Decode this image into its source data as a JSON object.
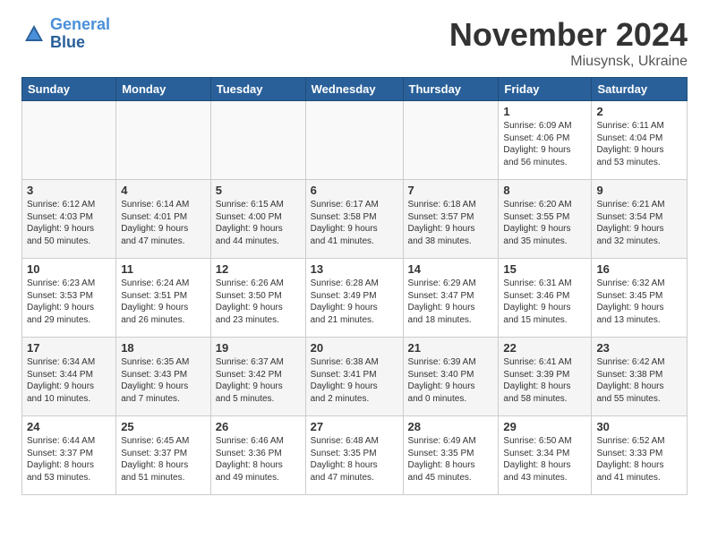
{
  "header": {
    "logo_line1": "General",
    "logo_line2": "Blue",
    "month": "November 2024",
    "location": "Miusynsk, Ukraine"
  },
  "days_of_week": [
    "Sunday",
    "Monday",
    "Tuesday",
    "Wednesday",
    "Thursday",
    "Friday",
    "Saturday"
  ],
  "weeks": [
    [
      {
        "num": "",
        "info": ""
      },
      {
        "num": "",
        "info": ""
      },
      {
        "num": "",
        "info": ""
      },
      {
        "num": "",
        "info": ""
      },
      {
        "num": "",
        "info": ""
      },
      {
        "num": "1",
        "info": "Sunrise: 6:09 AM\nSunset: 4:06 PM\nDaylight: 9 hours\nand 56 minutes."
      },
      {
        "num": "2",
        "info": "Sunrise: 6:11 AM\nSunset: 4:04 PM\nDaylight: 9 hours\nand 53 minutes."
      }
    ],
    [
      {
        "num": "3",
        "info": "Sunrise: 6:12 AM\nSunset: 4:03 PM\nDaylight: 9 hours\nand 50 minutes."
      },
      {
        "num": "4",
        "info": "Sunrise: 6:14 AM\nSunset: 4:01 PM\nDaylight: 9 hours\nand 47 minutes."
      },
      {
        "num": "5",
        "info": "Sunrise: 6:15 AM\nSunset: 4:00 PM\nDaylight: 9 hours\nand 44 minutes."
      },
      {
        "num": "6",
        "info": "Sunrise: 6:17 AM\nSunset: 3:58 PM\nDaylight: 9 hours\nand 41 minutes."
      },
      {
        "num": "7",
        "info": "Sunrise: 6:18 AM\nSunset: 3:57 PM\nDaylight: 9 hours\nand 38 minutes."
      },
      {
        "num": "8",
        "info": "Sunrise: 6:20 AM\nSunset: 3:55 PM\nDaylight: 9 hours\nand 35 minutes."
      },
      {
        "num": "9",
        "info": "Sunrise: 6:21 AM\nSunset: 3:54 PM\nDaylight: 9 hours\nand 32 minutes."
      }
    ],
    [
      {
        "num": "10",
        "info": "Sunrise: 6:23 AM\nSunset: 3:53 PM\nDaylight: 9 hours\nand 29 minutes."
      },
      {
        "num": "11",
        "info": "Sunrise: 6:24 AM\nSunset: 3:51 PM\nDaylight: 9 hours\nand 26 minutes."
      },
      {
        "num": "12",
        "info": "Sunrise: 6:26 AM\nSunset: 3:50 PM\nDaylight: 9 hours\nand 23 minutes."
      },
      {
        "num": "13",
        "info": "Sunrise: 6:28 AM\nSunset: 3:49 PM\nDaylight: 9 hours\nand 21 minutes."
      },
      {
        "num": "14",
        "info": "Sunrise: 6:29 AM\nSunset: 3:47 PM\nDaylight: 9 hours\nand 18 minutes."
      },
      {
        "num": "15",
        "info": "Sunrise: 6:31 AM\nSunset: 3:46 PM\nDaylight: 9 hours\nand 15 minutes."
      },
      {
        "num": "16",
        "info": "Sunrise: 6:32 AM\nSunset: 3:45 PM\nDaylight: 9 hours\nand 13 minutes."
      }
    ],
    [
      {
        "num": "17",
        "info": "Sunrise: 6:34 AM\nSunset: 3:44 PM\nDaylight: 9 hours\nand 10 minutes."
      },
      {
        "num": "18",
        "info": "Sunrise: 6:35 AM\nSunset: 3:43 PM\nDaylight: 9 hours\nand 7 minutes."
      },
      {
        "num": "19",
        "info": "Sunrise: 6:37 AM\nSunset: 3:42 PM\nDaylight: 9 hours\nand 5 minutes."
      },
      {
        "num": "20",
        "info": "Sunrise: 6:38 AM\nSunset: 3:41 PM\nDaylight: 9 hours\nand 2 minutes."
      },
      {
        "num": "21",
        "info": "Sunrise: 6:39 AM\nSunset: 3:40 PM\nDaylight: 9 hours\nand 0 minutes."
      },
      {
        "num": "22",
        "info": "Sunrise: 6:41 AM\nSunset: 3:39 PM\nDaylight: 8 hours\nand 58 minutes."
      },
      {
        "num": "23",
        "info": "Sunrise: 6:42 AM\nSunset: 3:38 PM\nDaylight: 8 hours\nand 55 minutes."
      }
    ],
    [
      {
        "num": "24",
        "info": "Sunrise: 6:44 AM\nSunset: 3:37 PM\nDaylight: 8 hours\nand 53 minutes."
      },
      {
        "num": "25",
        "info": "Sunrise: 6:45 AM\nSunset: 3:37 PM\nDaylight: 8 hours\nand 51 minutes."
      },
      {
        "num": "26",
        "info": "Sunrise: 6:46 AM\nSunset: 3:36 PM\nDaylight: 8 hours\nand 49 minutes."
      },
      {
        "num": "27",
        "info": "Sunrise: 6:48 AM\nSunset: 3:35 PM\nDaylight: 8 hours\nand 47 minutes."
      },
      {
        "num": "28",
        "info": "Sunrise: 6:49 AM\nSunset: 3:35 PM\nDaylight: 8 hours\nand 45 minutes."
      },
      {
        "num": "29",
        "info": "Sunrise: 6:50 AM\nSunset: 3:34 PM\nDaylight: 8 hours\nand 43 minutes."
      },
      {
        "num": "30",
        "info": "Sunrise: 6:52 AM\nSunset: 3:33 PM\nDaylight: 8 hours\nand 41 minutes."
      }
    ]
  ]
}
